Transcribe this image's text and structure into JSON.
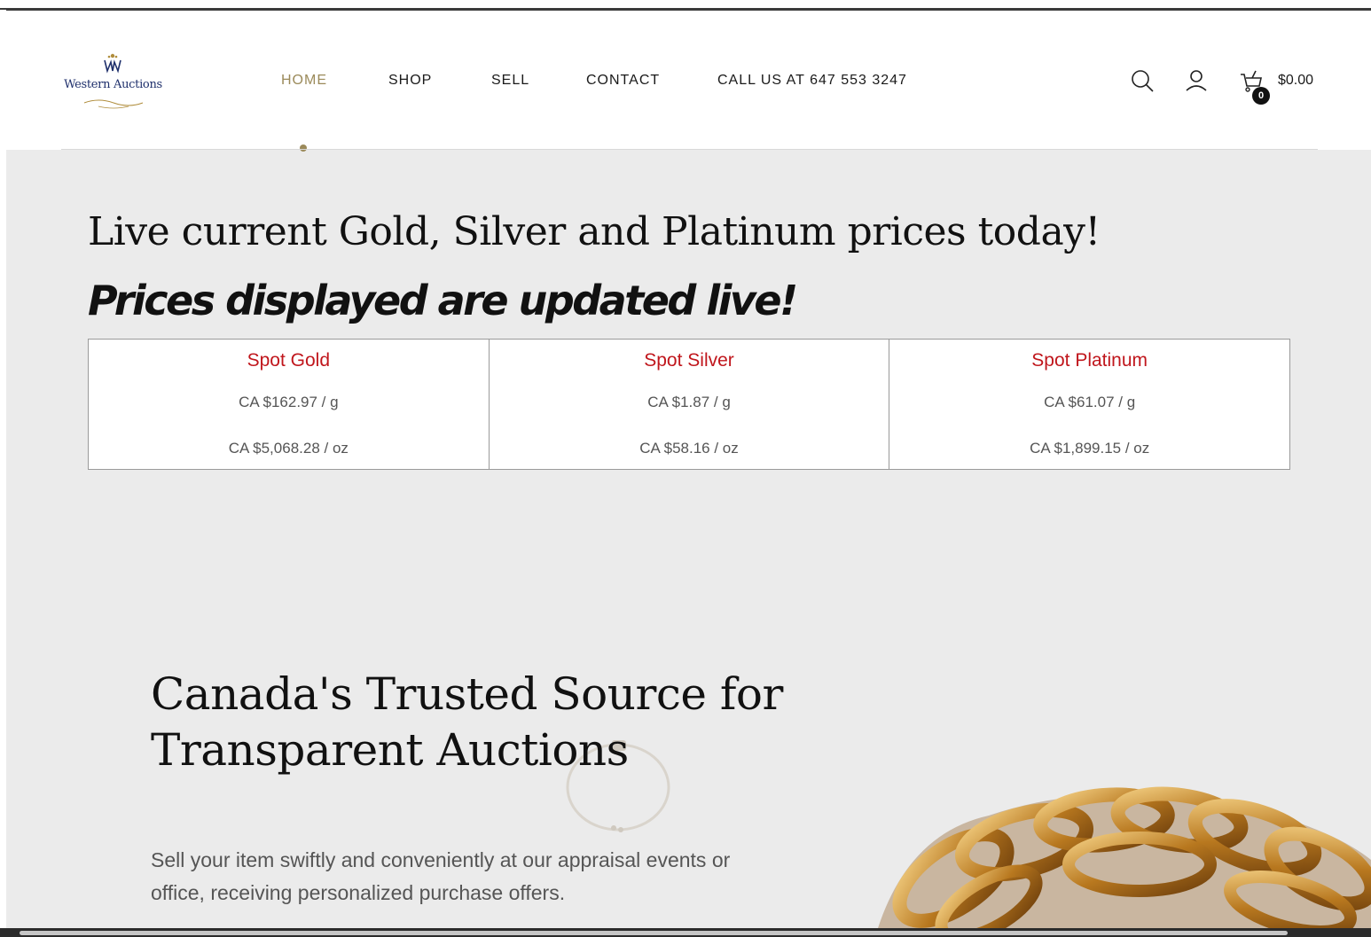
{
  "brand": {
    "logo_text": "Western Auctions"
  },
  "nav": {
    "items": [
      {
        "label": "HOME",
        "active": true
      },
      {
        "label": "SHOP",
        "active": false
      },
      {
        "label": "SELL",
        "active": false
      },
      {
        "label": "CONTACT",
        "active": false
      },
      {
        "label": "CALL US AT 647 553 3247",
        "active": false
      }
    ]
  },
  "header_icons": {
    "search": "search-icon",
    "account": "user-icon",
    "cart": "cart-icon"
  },
  "cart": {
    "count": "0",
    "total": "$0.00"
  },
  "prices_section": {
    "heading": "Live current Gold, Silver and Platinum prices today!",
    "subheading": "Prices displayed are updated live!",
    "columns": [
      {
        "title": "Spot Gold",
        "per_gram": "CA $162.97 / g",
        "per_ounce": "CA $5,068.28 / oz"
      },
      {
        "title": "Spot Silver",
        "per_gram": "CA $1.87 / g",
        "per_ounce": "CA $58.16 / oz"
      },
      {
        "title": "Spot Platinum",
        "per_gram": "CA $61.07 / g",
        "per_ounce": "CA $1,899.15 / oz"
      }
    ]
  },
  "hero": {
    "title": "Canada's Trusted Source for Transparent Auctions",
    "subtitle": "Sell your item swiftly and conveniently at our appraisal events or office, receiving personalized purchase offers."
  },
  "colors": {
    "accent_gold": "#9b8a5a",
    "price_red": "#c0161c",
    "brand_navy": "#1e2f6b",
    "background": "#ebebeb"
  }
}
